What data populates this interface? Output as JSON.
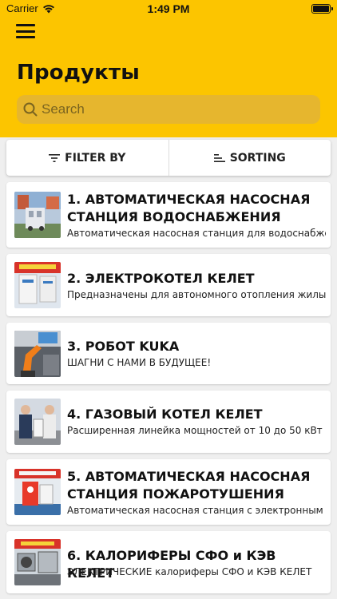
{
  "status_bar": {
    "carrier": "Carrier",
    "time": "1:49 PM"
  },
  "header": {
    "title": "Продукты"
  },
  "search": {
    "placeholder": "Search"
  },
  "toolbar": {
    "filter_label": "FILTER BY",
    "sorting_label": "SORTING"
  },
  "colors": {
    "header_bg": "#fcc500",
    "search_bg": "#e6b62e",
    "page_bg": "#efefef"
  },
  "products": [
    {
      "title": "1. АВТОМАТИЧЕСКАЯ НАСОСНАЯ СТАНЦИЯ ВОДОСНАБЖЕНИЯ",
      "description": "  Автоматическая насосная станция для водоснабжения",
      "icon": "pump-station-photo"
    },
    {
      "title": "2. ЭЛЕКТРОКОТЕЛ КЕЛЕТ",
      "description": "Предназначены для автономного отопления  жилых и",
      "icon": "electric-boiler-photo"
    },
    {
      "title": "3. РОБОТ KUKA",
      "description": "ШАГНИ С НАМИ В БУДУЩЕЕ!",
      "icon": "robot-photo"
    },
    {
      "title": "4. ГАЗОВЫЙ КОТЕЛ КЕЛЕТ",
      "description": "Расширенная линейка мощностей от 10 до 50 кВт",
      "icon": "gas-boiler-photo"
    },
    {
      "title": "5. АВТОМАТИЧЕСКАЯ НАСОСНАЯ СТАНЦИЯ ПОЖАРОТУШЕНИЯ",
      "description": "  Автоматическая насосная станция с электронным управлением",
      "icon": "fire-pump-photo"
    },
    {
      "title": "6. КАЛОРИФЕРЫ СФО и КЭВ КЕЛЕТ",
      "description": "ЭЛЕКТРИЧЕСКИЕ калориферы СФО и КЭВ  КЕЛЕТ",
      "icon": "heater-photo"
    }
  ]
}
